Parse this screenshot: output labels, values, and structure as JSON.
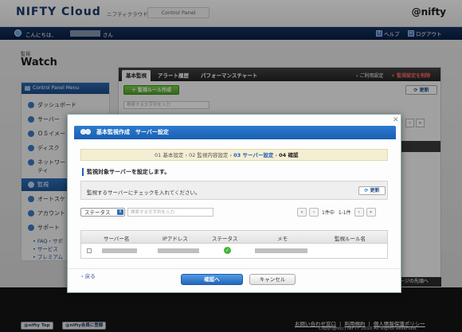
{
  "header": {
    "logo": "NIFTY Cloud",
    "logo_sub": "ニフティクラウド",
    "control_panel_tab": "Control Panel",
    "brand": "@nifty"
  },
  "user_bar": {
    "greeting": "こんにちは、",
    "suffix": "さん",
    "help": "ヘルプ",
    "logout": "ログアウト"
  },
  "page": {
    "section_small": "監視",
    "title": "Watch"
  },
  "sidebar": {
    "header": "Control Panel Menu",
    "items": [
      {
        "label": "ダッシュボード"
      },
      {
        "label": "サーバー"
      },
      {
        "label": "ＯＳイメー"
      },
      {
        "label": "ディスク"
      },
      {
        "label": "ネットワー"
      },
      {
        "label": "ティ"
      },
      {
        "label": "監視"
      },
      {
        "label": "オートスケ"
      },
      {
        "label": "アカウント"
      },
      {
        "label": "サポート"
      }
    ],
    "sub_links": [
      "FAQ・サポ",
      "サービス",
      "プレミアム"
    ]
  },
  "main_tabs": {
    "tabs": [
      "基本監視",
      "アラート履歴",
      "パフォーマンスチャート"
    ],
    "usage_guide": "ご利用設定",
    "delete_settings": "監視設定を削除",
    "create_rule_button": "監視ルール作成",
    "update_button": "更新",
    "search_placeholder": "検索する文字列を入力"
  },
  "bg_fragments": {
    "dark_row": "",
    "bottom_tag": "ージの先頭へ"
  },
  "modal": {
    "close": "✕",
    "title": "基本監視作成　サーバー設定",
    "steps": {
      "s1": "01 基本設定",
      "sep1": " › ",
      "s2": "02 監視内容設定",
      "sep2": " › ",
      "s3": "03 サーバー設定",
      "sep3": " › ",
      "s4": "04 確認"
    },
    "section_label": "監視対象サーバーを設定します。",
    "instruction": "監視するサーバーにチェックを入れてください。",
    "refresh_button": "更新",
    "status_select": "ステータス",
    "filter_placeholder": "検索する文字列を入力",
    "page_info": "1件中",
    "page_range": "1-1件",
    "table_headers": [
      "サーバー名",
      "IPアドレス",
      "ステータス",
      "メモ",
      "監視ルール名"
    ],
    "back_link": "戻る",
    "confirm_button": "確認へ",
    "cancel_button": "キャンセル"
  },
  "footer": {
    "links": [
      "お問い合わせ窓口",
      "利用規約",
      "個人情報保護ポリシー"
    ],
    "copyright": "Copyright(c) NIFTY 2010 All Rights Reserved.",
    "badge1": "@nifty Top",
    "badge2": "@nifty会員に登録"
  },
  "colors": {
    "accent_blue": "#2567b8",
    "nav_dark": "#0a1f44",
    "status_ok": "#45b438",
    "delete_red": "#ff6a6a"
  }
}
